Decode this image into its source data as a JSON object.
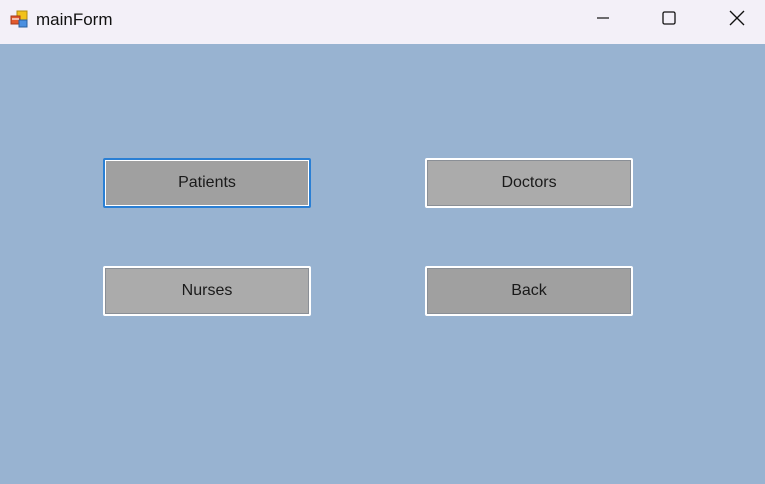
{
  "window": {
    "title": "mainForm",
    "icon": "winforms-app-icon",
    "controls": [
      "minimize-icon",
      "maximize-icon",
      "close-icon"
    ]
  },
  "colors": {
    "titlebar": "#f3f0f8",
    "client_background": "#98b3d1",
    "button_face": "#ababab",
    "button_face_dark": "#a0a0a0",
    "focus_border": "#2a7fd4"
  },
  "buttons": {
    "patients": "Patients",
    "doctors": "Doctors",
    "nurses": "Nurses",
    "back": "Back"
  }
}
